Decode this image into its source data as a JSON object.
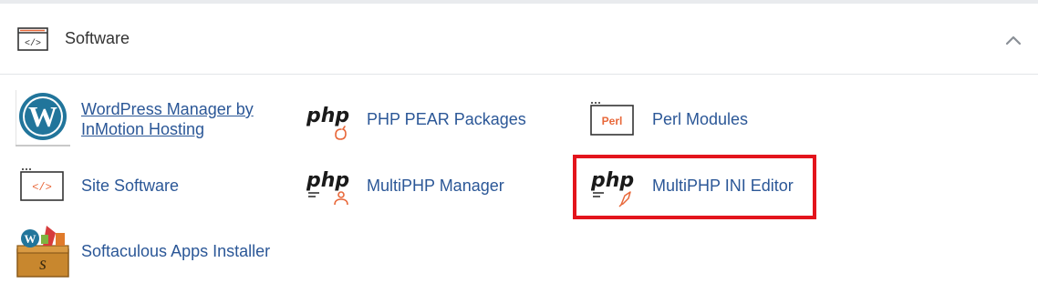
{
  "section": {
    "title": "Software",
    "header_icon": "code-window-icon",
    "collapse_icon": "chevron-up-icon"
  },
  "items": [
    {
      "label_line1": "WordPress Manager by",
      "label_line2": "InMotion Hosting",
      "icon": "wordpress-logo-icon"
    },
    {
      "label": "PHP PEAR Packages",
      "icon": "php-pear-icon",
      "icon_text": "php"
    },
    {
      "label": "Perl Modules",
      "icon": "perl-icon",
      "icon_text": "Perl"
    },
    {
      "label": "Site Software",
      "icon": "code-window-icon"
    },
    {
      "label": "MultiPHP Manager",
      "icon": "multiphp-manager-icon",
      "icon_text": "php"
    },
    {
      "label": "MultiPHP INI Editor",
      "icon": "multiphp-ini-editor-icon",
      "icon_text": "php"
    },
    {
      "label": "Softaculous Apps Installer",
      "icon": "softaculous-icon"
    }
  ],
  "colors": {
    "link": "#2b5797",
    "accent_orange": "#e8683a",
    "highlight_border": "#e3141c",
    "wordpress_blue": "#21759b"
  }
}
